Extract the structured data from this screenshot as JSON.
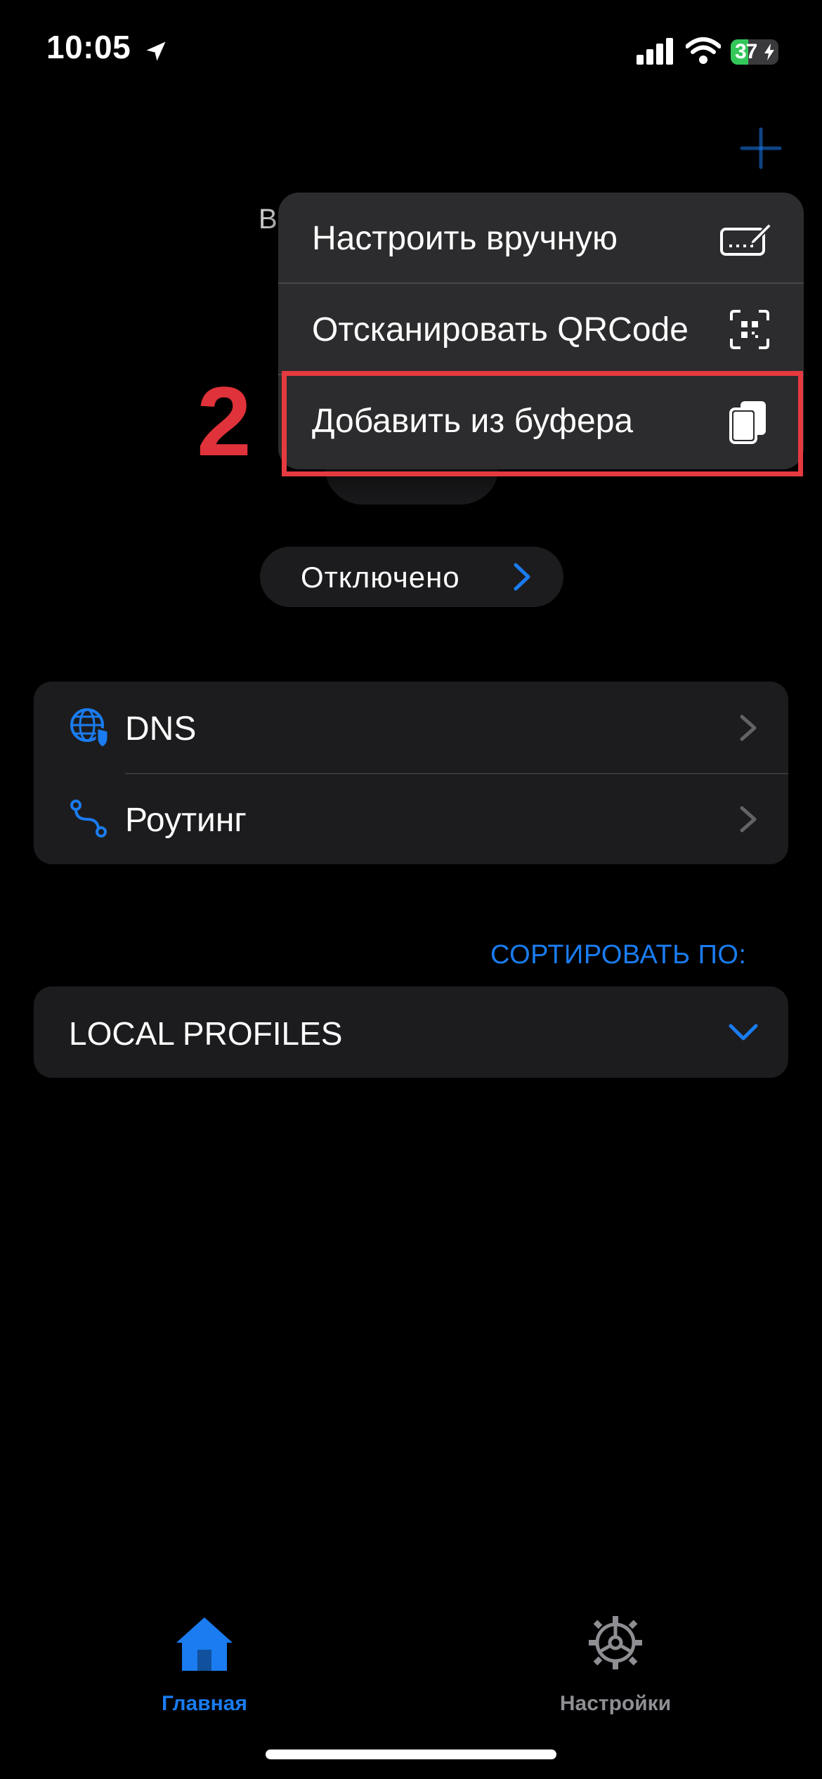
{
  "status_bar": {
    "time": "10:05",
    "battery_percent": 37,
    "battery_label": "37"
  },
  "header": {
    "add_icon": "plus-icon",
    "stray_text": "В"
  },
  "menu": {
    "items": [
      {
        "label": "Настроить вручную",
        "icon": "keyboard-pencil-icon"
      },
      {
        "label": "Отсканировать QRCode",
        "icon": "qrcode-scan-icon"
      },
      {
        "label": "Добавить из буфера",
        "icon": "clipboard-copy-icon"
      }
    ]
  },
  "annotation": {
    "step_number": "2",
    "highlight_color": "#e53a40"
  },
  "connection": {
    "status_label": "Отключено"
  },
  "settings_list": [
    {
      "label": "DNS",
      "icon": "globe-shield-icon"
    },
    {
      "label": "Роутинг",
      "icon": "route-icon"
    }
  ],
  "sort": {
    "label": "СОРТИРОВАТЬ ПО:",
    "selected": "LOCAL PROFILES"
  },
  "tab_bar": {
    "tabs": [
      {
        "label": "Главная",
        "icon": "house-icon",
        "active": true
      },
      {
        "label": "Настройки",
        "icon": "gear-icon",
        "active": false
      }
    ]
  },
  "colors": {
    "accent": "#1a7cf0",
    "background": "#000000",
    "card": "#1c1c1e",
    "menu": "#2c2c2e",
    "battery": "#34c759"
  }
}
